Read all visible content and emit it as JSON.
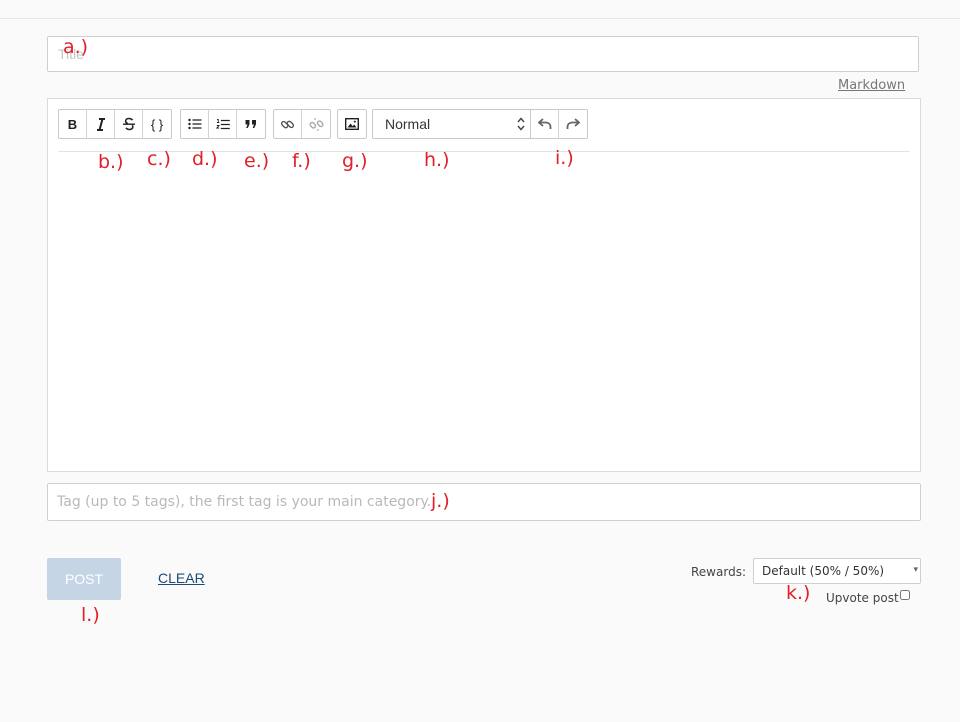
{
  "form": {
    "title_placeholder": "Title",
    "markdown_link": "Markdown",
    "tags_placeholder": "Tag (up to 5 tags), the first tag is your main category.",
    "post_label": "POST",
    "clear_label": "CLEAR",
    "rewards_label": "Rewards:",
    "rewards_value": "Default (50% / 50%)",
    "upvote_label": "Upvote post"
  },
  "toolbar": {
    "bold_label": "B",
    "code_label": "{ }",
    "heading_select": "Normal",
    "icons": [
      "bold-icon",
      "italic-icon",
      "strikethrough-icon",
      "code-icon",
      "bullet-list-icon",
      "numbered-list-icon",
      "quote-icon",
      "link-icon",
      "unlink-icon",
      "image-icon",
      "undo-icon",
      "redo-icon"
    ]
  },
  "annotations": {
    "a": "a.)",
    "b": "b.)",
    "c": "c.)",
    "d": "d.)",
    "e": "e.)",
    "f": "f.)",
    "g": "g.)",
    "h": "h.)",
    "i": "i.)",
    "j": "j.)",
    "k": "k.)",
    "l": "l.)"
  },
  "colors": {
    "annotation": "#e0212a",
    "post_button_bg": "#c6d5e5",
    "clear_link": "#1b4b76"
  }
}
